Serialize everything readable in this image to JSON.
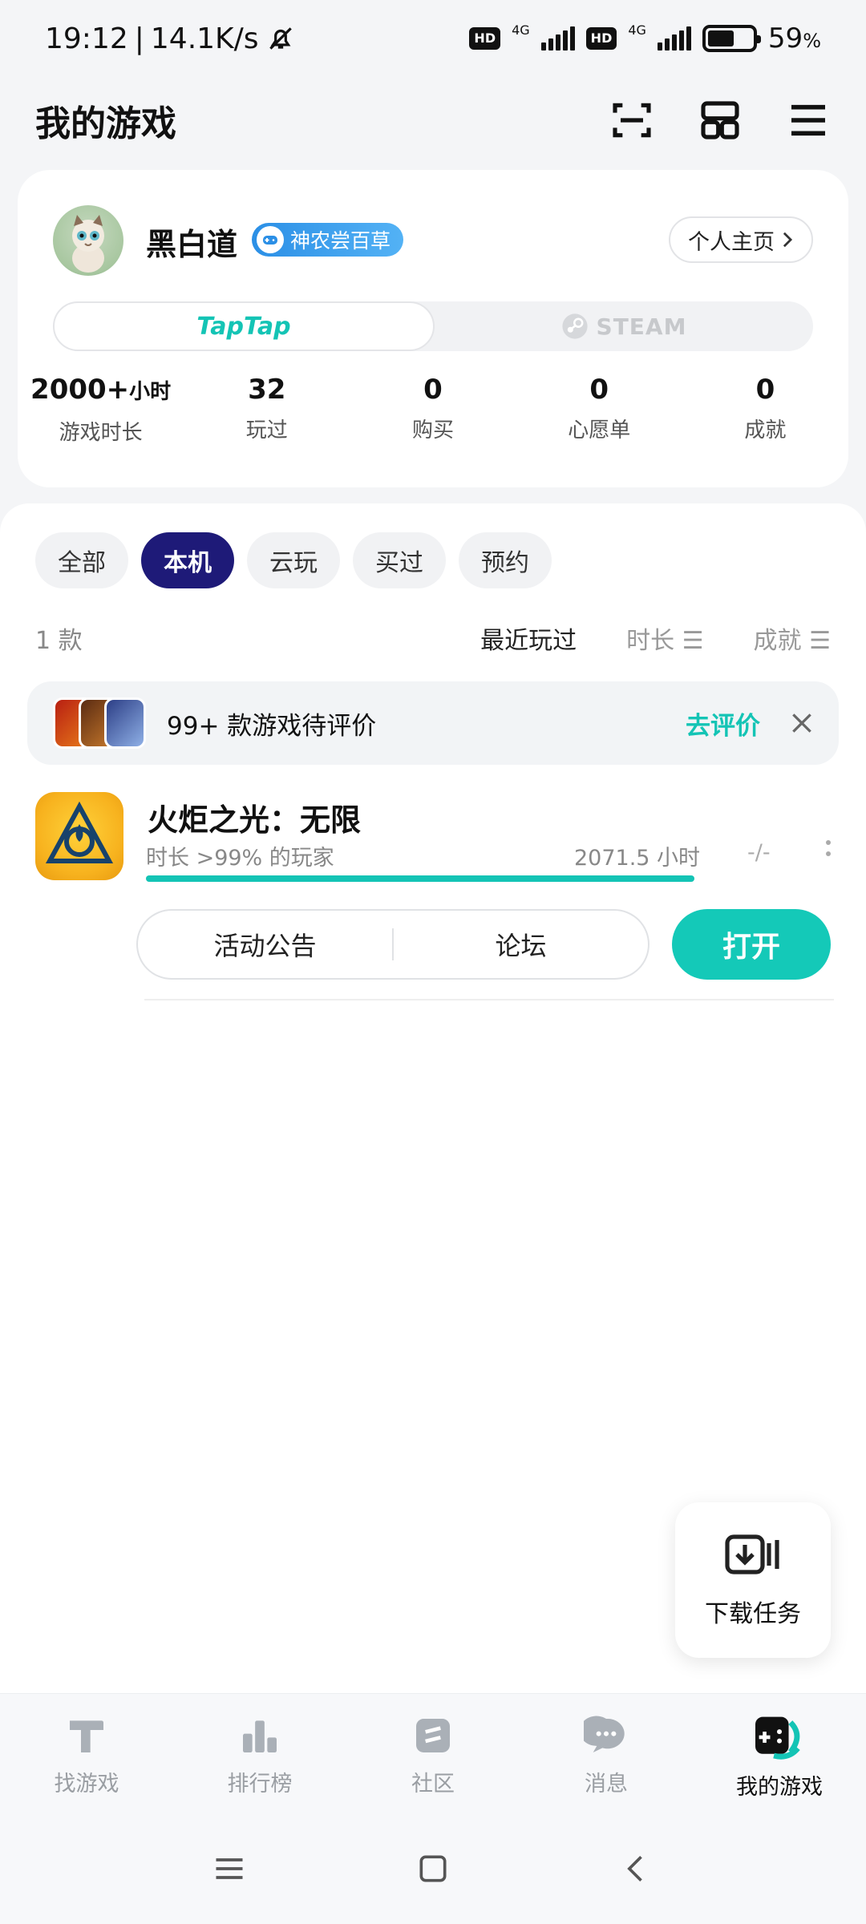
{
  "status_bar": {
    "time": "19:12",
    "speed": "14.1K/s",
    "net1": "4G",
    "net2": "4G",
    "hd": "HD",
    "battery": "59",
    "battery_unit": "%",
    "battery_level": 0.59
  },
  "header": {
    "title": "我的游戏",
    "icons": [
      "scan-icon",
      "grid-icon",
      "menu-icon"
    ]
  },
  "profile": {
    "username": "黑白道",
    "badge": "神农尝百草",
    "home_button": "个人主页",
    "platforms": {
      "taptap": "TapTap",
      "steam": "STEAM"
    },
    "stats": [
      {
        "value": "2000+",
        "unit": "小时",
        "label": "游戏时长"
      },
      {
        "value": "32",
        "unit": "",
        "label": "玩过"
      },
      {
        "value": "0",
        "unit": "",
        "label": "购买"
      },
      {
        "value": "0",
        "unit": "",
        "label": "心愿单"
      },
      {
        "value": "0",
        "unit": "",
        "label": "成就"
      }
    ]
  },
  "filters": {
    "chips": [
      "全部",
      "本机",
      "云玩",
      "买过",
      "预约"
    ],
    "active": "本机",
    "count": "1 款",
    "sorts": [
      "最近玩过",
      "时长",
      "成就"
    ]
  },
  "rating_prompt": {
    "text": "99+ 款游戏待评价",
    "link": "去评价"
  },
  "game": {
    "title": "火炬之光：无限",
    "subtitle": "时长 >99% 的玩家",
    "hours": "2071.5 小时",
    "ratio": "-/-",
    "progress": 1.0,
    "actions": [
      "活动公告",
      "论坛"
    ],
    "open": "打开"
  },
  "download": {
    "label": "下载任务"
  },
  "bottom_nav": [
    {
      "label": "找游戏",
      "icon": "find-games-icon"
    },
    {
      "label": "排行榜",
      "icon": "ranking-icon"
    },
    {
      "label": "社区",
      "icon": "community-icon"
    },
    {
      "label": "消息",
      "icon": "message-icon"
    },
    {
      "label": "我的游戏",
      "icon": "my-games-icon",
      "active": true
    }
  ],
  "colors": {
    "accent": "#14c4b5",
    "chip_active": "#1e1a78",
    "badge": "#2b8fe6"
  }
}
